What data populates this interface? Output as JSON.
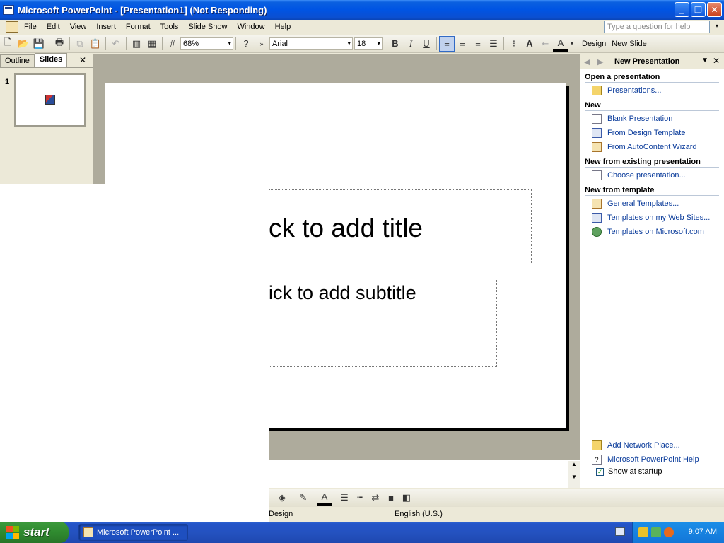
{
  "window": {
    "title": "Microsoft PowerPoint - [Presentation1] (Not Responding)",
    "controls": {
      "minimize": "_",
      "restore": "❐",
      "close": "✕"
    }
  },
  "menu": {
    "items": [
      "File",
      "Edit",
      "View",
      "Insert",
      "Format",
      "Tools",
      "Slide Show",
      "Window",
      "Help"
    ],
    "help_placeholder": "Type a question for help",
    "close": "✕"
  },
  "toolbar": {
    "zoom": "68%",
    "font_name": "Arial",
    "font_size": "18",
    "bold": "B",
    "italic": "I",
    "underline": "U",
    "design_label": "Design",
    "new_slide_label": "New Slide"
  },
  "left_pane": {
    "tabs": [
      "Outline",
      "Slides"
    ],
    "active_tab": "Slides",
    "close": "✕",
    "slide_number": "1"
  },
  "slide": {
    "title_placeholder": "ck to add title",
    "subtitle_placeholder": "ick to add subtitle"
  },
  "task_pane": {
    "title": "New Presentation",
    "back": "◆",
    "forward": "◆",
    "close": "✕",
    "sections": [
      {
        "heading": "Open a presentation",
        "links": [
          {
            "label": "Presentations...",
            "icon": "folder-icon"
          }
        ]
      },
      {
        "heading": "New",
        "links": [
          {
            "label": "Blank Presentation",
            "icon": "blank-doc-icon"
          },
          {
            "label": "From Design Template",
            "icon": "design-template-icon"
          },
          {
            "label": "From AutoContent Wizard",
            "icon": "wizard-icon"
          }
        ]
      },
      {
        "heading": "New from existing presentation",
        "links": [
          {
            "label": "Choose presentation...",
            "icon": "blank-doc-icon"
          }
        ]
      },
      {
        "heading": "New from template",
        "links": [
          {
            "label": "General Templates...",
            "icon": "template-icon"
          },
          {
            "label": "Templates on my Web Sites...",
            "icon": "web-template-icon"
          },
          {
            "label": "Templates on Microsoft.com",
            "icon": "globe-icon"
          }
        ]
      }
    ],
    "footer_links": [
      {
        "label": "Add Network Place...",
        "icon": "network-folder-icon"
      },
      {
        "label": "Microsoft PowerPoint Help",
        "icon": "help-icon"
      }
    ],
    "show_at_startup": {
      "label": "Show at startup",
      "checked": true
    }
  },
  "status_bar": {
    "design": "Design",
    "language": "English (U.S.)"
  },
  "taskbar": {
    "start_label": "start",
    "task_item": "Microsoft PowerPoint ...",
    "clock": "9:07 AM"
  },
  "colors": {
    "title_bar": "#0054e3",
    "workspace_gray": "#aeab9c",
    "link_blue": "#0b3c9b",
    "start_green": "#2f8a2f"
  }
}
